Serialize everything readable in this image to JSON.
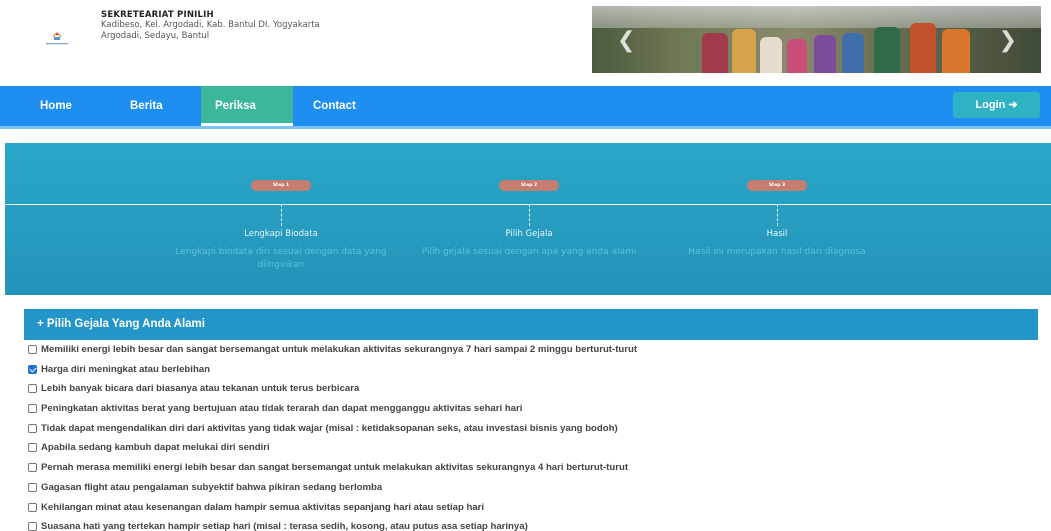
{
  "header": {
    "org_name": "SEKRETEARIAT PINILIH",
    "address_line1": "Kadibeso, Kel. Argodadi, Kab. Bantul DI. Yogyakarta",
    "address_line2": "Argodadi, Sedayu, Bantul",
    "carousel_prev_icon": "chevron-left-icon",
    "carousel_next_icon": "chevron-right-icon"
  },
  "nav": {
    "home": "Home",
    "berita": "Berita",
    "periksa": "Periksa",
    "contact": "Contact",
    "active": "Periksa",
    "login": "Login ➜"
  },
  "steps": [
    {
      "badge": "Step 1",
      "title": "Lengkapi Biodata",
      "desc": "Lengkapi biodata diri sesuai dengan data yang diinginkan"
    },
    {
      "badge": "Step 2",
      "title": "Pilih Gejala",
      "desc": "Pilih gejala sesuai dengan apa yang anda alami"
    },
    {
      "badge": "Step 3",
      "title": "Hasil",
      "desc": "Hasil ini merupakan hasil dari diagnosa"
    }
  ],
  "panel": {
    "title": "+ Pilih Gejala Yang Anda Alami"
  },
  "symptoms": [
    {
      "label": "Memiliki energi lebih besar dan sangat bersemangat untuk melakukan aktivitas sekurangnya 7 hari sampai 2 minggu berturut-turut",
      "checked": false
    },
    {
      "label": "Harga diri meningkat atau berlebihan",
      "checked": true
    },
    {
      "label": "Lebih banyak bicara dari biasanya atau tekanan untuk terus berbicara",
      "checked": false
    },
    {
      "label": "Peningkatan aktivitas berat yang bertujuan atau tidak terarah dan dapat mengganggu aktivitas sehari hari",
      "checked": false
    },
    {
      "label": "Tidak dapat mengendalikan diri dari aktivitas yang tidak wajar (misal : ketidaksopanan seks, atau investasi bisnis yang bodoh)",
      "checked": false
    },
    {
      "label": "Apabila sedang kambuh dapat melukai diri sendiri",
      "checked": false
    },
    {
      "label": "Pernah merasa memiliki energi lebih besar dan sangat bersemangat untuk melakukan aktivitas sekurangnya 4 hari berturut-turut",
      "checked": false
    },
    {
      "label": "Gagasan flight atau pengalaman subyektif bahwa pikiran sedang berlomba",
      "checked": false
    },
    {
      "label": "Kehilangan minat atau kesenangan dalam hampir semua aktivitas sepanjang hari atau setiap hari",
      "checked": false
    },
    {
      "label": "Suasana hati yang tertekan hampir setiap hari (misal : terasa sedih, kosong, atau putus asa setiap harinya)",
      "checked": false
    }
  ],
  "colors": {
    "nav_bg": "#1e8ff0",
    "nav_active": "#3bb89a",
    "login_bg": "#2fb2c4",
    "steps_bg": "#2aa7c8",
    "panel_header": "#2395c9",
    "step_badge": "#c47d6f"
  }
}
